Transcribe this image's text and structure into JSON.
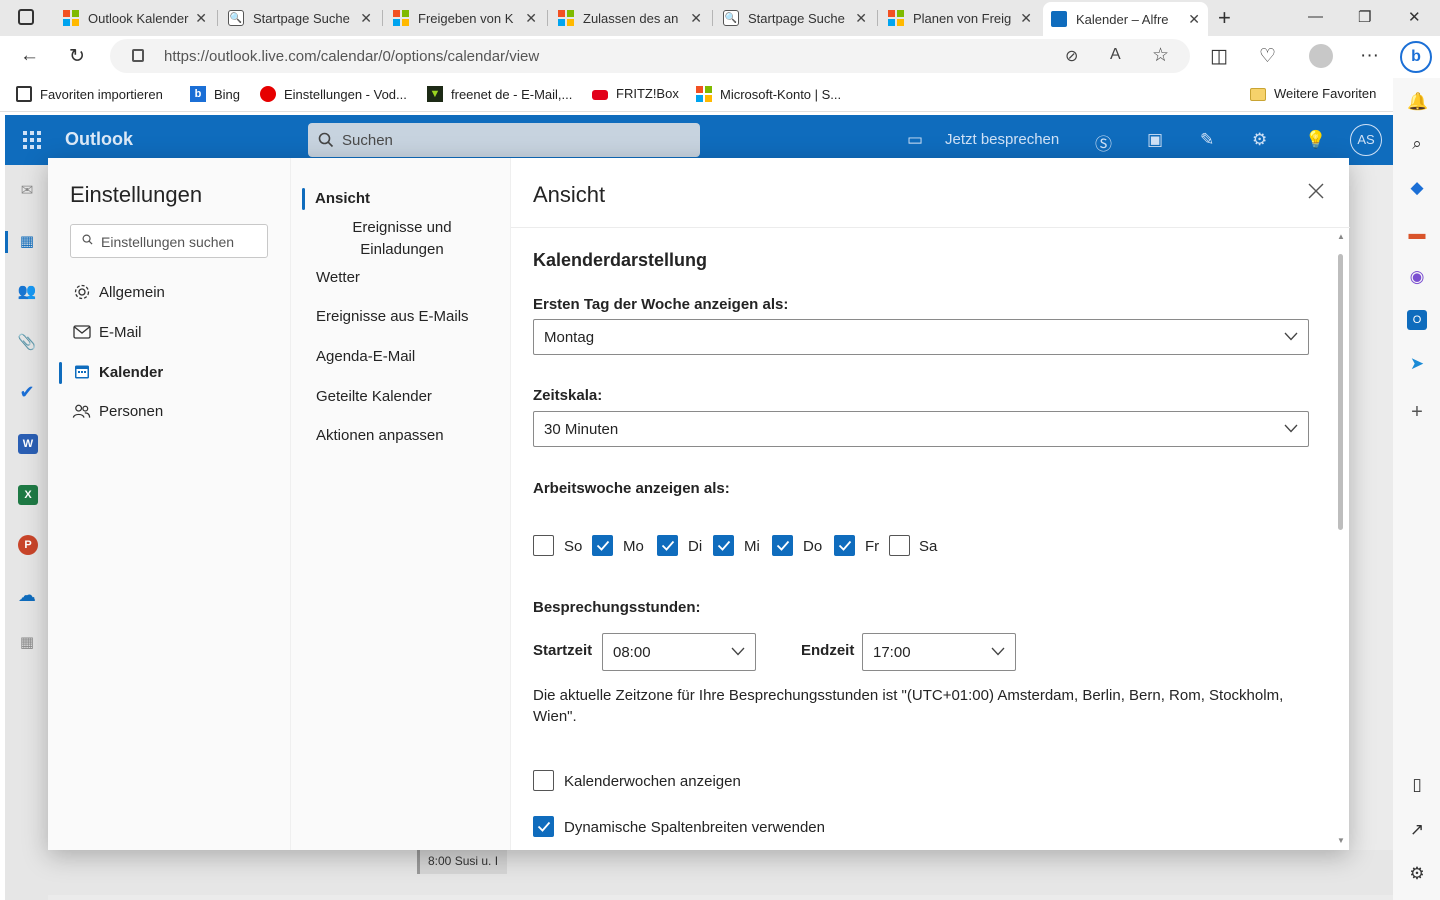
{
  "browser": {
    "tabs": [
      {
        "title": "Outlook Kalender",
        "icon": "microsoft-icon"
      },
      {
        "title": "Startpage Suche",
        "icon": "startpage-icon"
      },
      {
        "title": "Freigeben von K",
        "icon": "microsoft-icon"
      },
      {
        "title": "Zulassen des an",
        "icon": "microsoft-icon"
      },
      {
        "title": "Startpage Suche",
        "icon": "startpage-icon"
      },
      {
        "title": "Planen von Freig",
        "icon": "microsoft-icon"
      },
      {
        "title": "Kalender – Alfre",
        "icon": "outlook-calendar-icon"
      }
    ],
    "url": "https://outlook.live.com/calendar/0/options/calendar/view",
    "favorites": [
      {
        "label": "Favoriten importieren"
      },
      {
        "label": "Bing"
      },
      {
        "label": "Einstellungen - Vod..."
      },
      {
        "label": "freenet de - E-Mail,..."
      },
      {
        "label": "FRITZ!Box"
      },
      {
        "label": "Microsoft-Konto | S..."
      }
    ],
    "more_favorites": "Weitere Favoriten"
  },
  "outlook": {
    "brand": "Outlook",
    "search_placeholder": "Suchen",
    "meet_now": "Jetzt besprechen",
    "avatar_initials": "AS",
    "calendar_event": "8:00 Susi u. I"
  },
  "settings": {
    "title": "Einstellungen",
    "search_placeholder": "Einstellungen suchen",
    "nav": [
      {
        "label": "Allgemein"
      },
      {
        "label": "E-Mail"
      },
      {
        "label": "Kalender"
      },
      {
        "label": "Personen"
      }
    ],
    "subnav": [
      {
        "label": "Ansicht"
      },
      {
        "label": "Ereignisse und Einladungen"
      },
      {
        "label": "Wetter"
      },
      {
        "label": "Ereignisse aus E-Mails"
      },
      {
        "label": "Agenda-E-Mail"
      },
      {
        "label": "Geteilte Kalender"
      },
      {
        "label": "Aktionen anpassen"
      }
    ]
  },
  "view_pane": {
    "title": "Ansicht",
    "section": "Kalenderdarstellung",
    "first_day_label": "Ersten Tag der Woche anzeigen als:",
    "first_day_value": "Montag",
    "timescale_label": "Zeitskala:",
    "timescale_value": "30 Minuten",
    "work_week_label": "Arbeitswoche anzeigen als:",
    "days": [
      {
        "label": "So",
        "checked": false
      },
      {
        "label": "Mo",
        "checked": true
      },
      {
        "label": "Di",
        "checked": true
      },
      {
        "label": "Mi",
        "checked": true
      },
      {
        "label": "Do",
        "checked": true
      },
      {
        "label": "Fr",
        "checked": true
      },
      {
        "label": "Sa",
        "checked": false
      }
    ],
    "meeting_hours_label": "Besprechungsstunden:",
    "start_label": "Startzeit",
    "start_value": "08:00",
    "end_label": "Endzeit",
    "end_value": "17:00",
    "timezone_note": "Die aktuelle Zeitzone für Ihre Besprechungsstunden ist \"(UTC+01:00) Amsterdam, Berlin, Bern, Rom, Stockholm, Wien\".",
    "show_week_numbers": {
      "label": "Kalenderwochen anzeigen",
      "checked": false
    },
    "dynamic_columns": {
      "label": "Dynamische Spaltenbreiten verwenden",
      "checked": true
    }
  },
  "colors": {
    "accent": "#0f6cbd",
    "ms_red": "#f25022",
    "ms_green": "#7fba00",
    "ms_blue": "#00a4ef",
    "ms_yellow": "#ffb900"
  }
}
